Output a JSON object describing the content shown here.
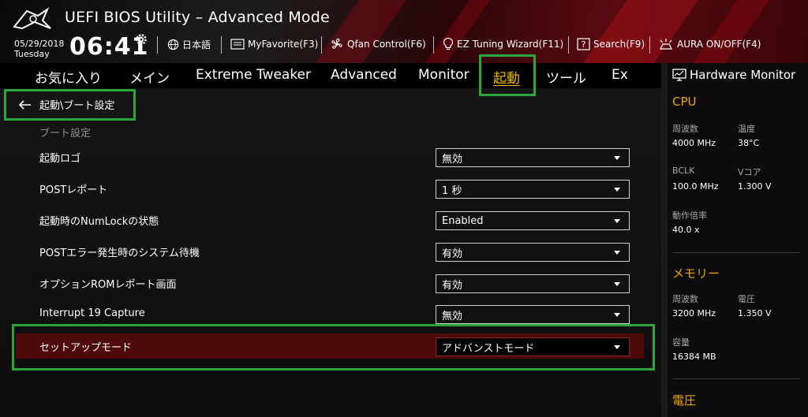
{
  "header": {
    "title": "UEFI BIOS Utility – Advanced Mode",
    "date": "05/29/2018",
    "day": "Tuesday",
    "time": "06:41",
    "toolbar": [
      {
        "label": "日本語",
        "icon": "globe-icon"
      },
      {
        "label": "MyFavorite(F3)",
        "icon": "favorite-list-icon"
      },
      {
        "label": "Qfan Control(F6)",
        "icon": "fan-icon"
      },
      {
        "label": "EZ Tuning Wizard(F11)",
        "icon": "lightbulb-icon"
      },
      {
        "label": "Search(F9)",
        "icon": "search-help-icon"
      },
      {
        "label": "AURA ON/OFF(F4)",
        "icon": "aura-light-icon"
      }
    ]
  },
  "nav": {
    "tabs": [
      "お気に入り",
      "メイン",
      "Extreme Tweaker",
      "Advanced",
      "Monitor",
      "起動",
      "ツール",
      "Ex"
    ],
    "active": "起動"
  },
  "main": {
    "breadcrumb": "起動\\ブート設定",
    "section": "ブート設定",
    "settings": [
      {
        "label": "起動ロゴ",
        "value": "無効"
      },
      {
        "label": "POSTレポート",
        "value": "1 秒"
      },
      {
        "label": "起動時のNumLockの状態",
        "value": "Enabled"
      },
      {
        "label": "POSTエラー発生時のシステム待機",
        "value": "有効"
      },
      {
        "label": "オプションROMレポート画面",
        "value": "有効"
      },
      {
        "label": "Interrupt 19 Capture",
        "value": "無効"
      },
      {
        "label": "セットアップモード",
        "value": "アドバンストモード"
      }
    ]
  },
  "hardware_monitor": {
    "title": "Hardware Monitor",
    "cpu": {
      "heading": "CPU",
      "freq_label": "周波数",
      "freq_value": "4000 MHz",
      "temp_label": "温度",
      "temp_value": "38°C",
      "bclk_label": "BCLK",
      "bclk_value": "100.0 MHz",
      "vcore_label": "Vコア",
      "vcore_value": "1.300 V",
      "ratio_label": "動作倍率",
      "ratio_value": "40.0 x"
    },
    "memory": {
      "heading": "メモリー",
      "freq_label": "周波数",
      "freq_value": "3200 MHz",
      "volt_label": "電圧",
      "volt_value": "1.350 V",
      "cap_label": "容量",
      "cap_value": "16384 MB"
    },
    "voltage": {
      "heading": "電圧"
    }
  },
  "colors": {
    "accent": "#f0a500",
    "highlight_row": "#4e0a0b",
    "annotation_box": "#2aa63a"
  }
}
